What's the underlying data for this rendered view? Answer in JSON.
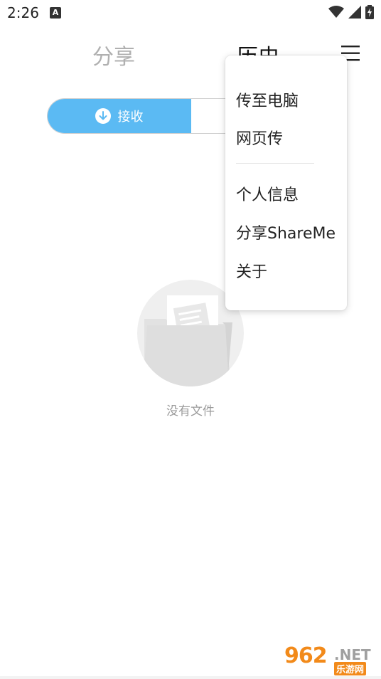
{
  "status_bar": {
    "time": "2:26",
    "notification_icon": "A",
    "icons": [
      "wifi-icon",
      "signal-icon",
      "battery-charging-icon"
    ]
  },
  "tabs": {
    "share_label": "分享",
    "history_label": "历史",
    "active": "history"
  },
  "toggle": {
    "receive_label": "接收",
    "receive_icon": "download-arrow-icon"
  },
  "empty_state": {
    "icon": "empty-folder-icon",
    "message": "没有文件"
  },
  "menu": {
    "items": [
      {
        "label": "传至电脑"
      },
      {
        "label": "网页传"
      },
      {
        "label": "个人信息"
      },
      {
        "label": "分享ShareMe"
      },
      {
        "label": "关于"
      }
    ]
  },
  "watermark": {
    "number": "962",
    "domain": ".NET",
    "site_name": "乐游网"
  },
  "colors": {
    "accent": "#5bbaf3",
    "inactive_tab": "#b0b0b0",
    "watermark_orange": "#f28a1a"
  }
}
